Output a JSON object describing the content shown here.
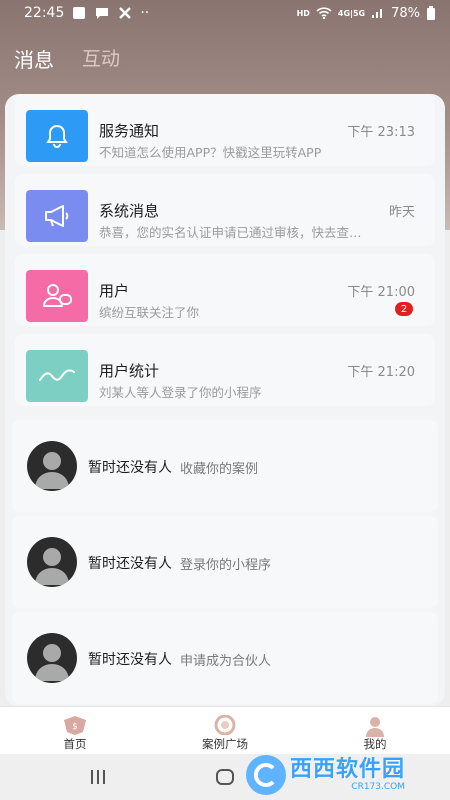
{
  "status_bar": {
    "time": "22:45",
    "network_label": "HD",
    "signal_label": "4G|5G",
    "battery": "78%"
  },
  "header": {
    "tabs": [
      {
        "label": "消息",
        "active": true
      },
      {
        "label": "互动",
        "active": false
      }
    ]
  },
  "notices": [
    {
      "icon": "bell-icon",
      "color": "#2d9bf5",
      "title": "服务通知",
      "desc": "不知道怎么使用APP？快戳这里玩转APP",
      "time": "下午 23:13"
    },
    {
      "icon": "megaphone-icon",
      "color": "#7b8cf0",
      "title": "系统消息",
      "desc": "恭喜，您的实名认证申请已通过审核，快去查…",
      "time": "昨天"
    },
    {
      "icon": "users-icon",
      "color": "#f46ba6",
      "title": "用户",
      "desc": "缤纷互联关注了你",
      "time": "下午 21:00",
      "badge": "2"
    },
    {
      "icon": "trend-wave-icon",
      "color": "#7dcfc4",
      "title": "用户统计",
      "desc": "刘某人等人登录了你的小程序",
      "time": "下午 21:20"
    }
  ],
  "empty_items": [
    {
      "title": "暂时还没有人",
      "desc": "收藏你的案例"
    },
    {
      "title": "暂时还没有人",
      "desc": "登录你的小程序"
    },
    {
      "title": "暂时还没有人",
      "desc": "申请成为合伙人"
    }
  ],
  "tabbar": {
    "items": [
      {
        "label": "首页",
        "icon": "home-icon"
      },
      {
        "label": "案例广场",
        "icon": "case-plaza-icon"
      },
      {
        "label": "我的",
        "icon": "profile-icon"
      }
    ]
  },
  "watermark": {
    "cn": "西西软件园",
    "en": "CR173.COM"
  }
}
